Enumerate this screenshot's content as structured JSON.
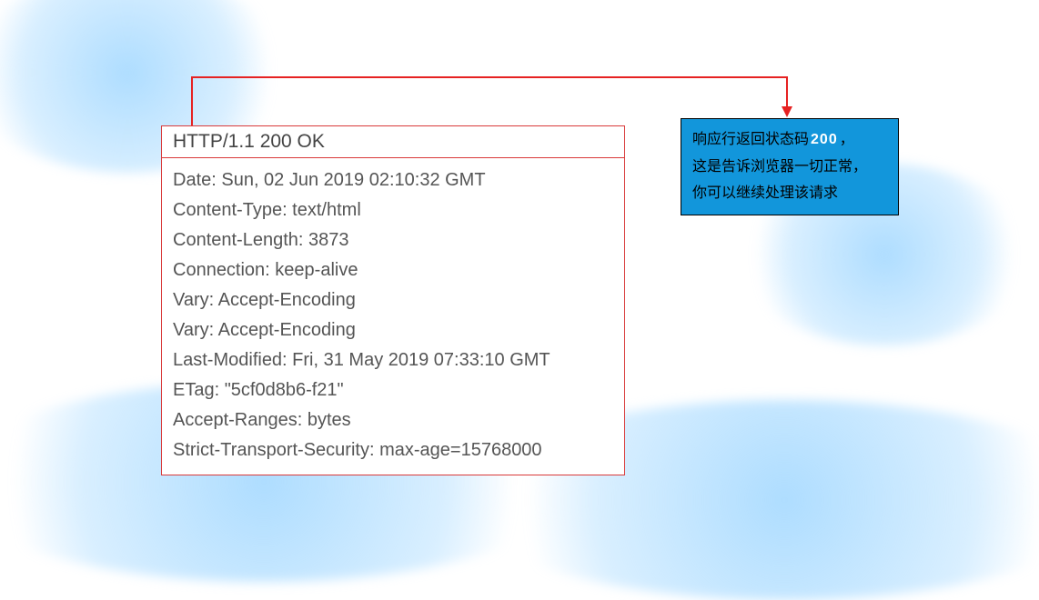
{
  "response": {
    "status_line": "HTTP/1.1 200 OK",
    "headers": [
      "Date: Sun, 02 Jun 2019 02:10:32 GMT",
      "Content-Type: text/html",
      "Content-Length: 3873",
      "Connection: keep-alive",
      "Vary: Accept-Encoding",
      "Vary: Accept-Encoding",
      "Last-Modified: Fri, 31 May 2019 07:33:10 GMT",
      "ETag: \"5cf0d8b6-f21\"",
      "Accept-Ranges: bytes",
      "Strict-Transport-Security: max-age=15768000"
    ]
  },
  "annotation": {
    "line1_pre": "响应行返回状态码",
    "line1_code": "200",
    "line1_post": "，",
    "line2": "这是告诉浏览器一切正常，",
    "line3": "你可以继续处理该请求"
  }
}
